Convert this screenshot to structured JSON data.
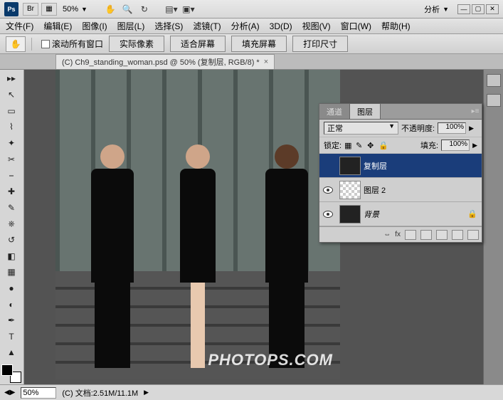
{
  "titlebar": {
    "app_label": "Ps",
    "br_label": "Br",
    "zoom": "50%",
    "analysis_menu": "分析"
  },
  "menu": {
    "file": "文件(F)",
    "edit": "编辑(E)",
    "image": "图像(I)",
    "layer": "图层(L)",
    "select": "选择(S)",
    "filter": "滤镜(T)",
    "analysis": "分析(A)",
    "threed": "3D(D)",
    "view": "视图(V)",
    "window": "窗口(W)",
    "help": "帮助(H)"
  },
  "options": {
    "scroll_all": "滚动所有窗口",
    "actual_pixels": "实际像素",
    "fit_screen": "适合屏幕",
    "fill_screen": "填充屏幕",
    "print_size": "打印尺寸"
  },
  "document": {
    "tab_title": "(C) Ch9_standing_woman.psd @ 50% (复制层, RGB/8) *"
  },
  "panel": {
    "tab_channels": "通道",
    "tab_layers": "图层",
    "blend_mode": "正常",
    "opacity_label": "不透明度:",
    "opacity_value": "100%",
    "lock_label": "锁定:",
    "fill_label": "填充:",
    "fill_value": "100%",
    "layers": [
      {
        "name": "复制层",
        "visible": false,
        "selected": true,
        "thumb": "dark"
      },
      {
        "name": "图层 2",
        "visible": true,
        "selected": false,
        "thumb": "checker"
      },
      {
        "name": "背景",
        "visible": true,
        "selected": false,
        "thumb": "dark",
        "locked": true,
        "italic": true
      }
    ],
    "footer_fx": "fx"
  },
  "status": {
    "zoom": "50%",
    "doc_info": "(C) 文档:2.51M/11.1M"
  },
  "watermark": "PHOTOPS.COM"
}
